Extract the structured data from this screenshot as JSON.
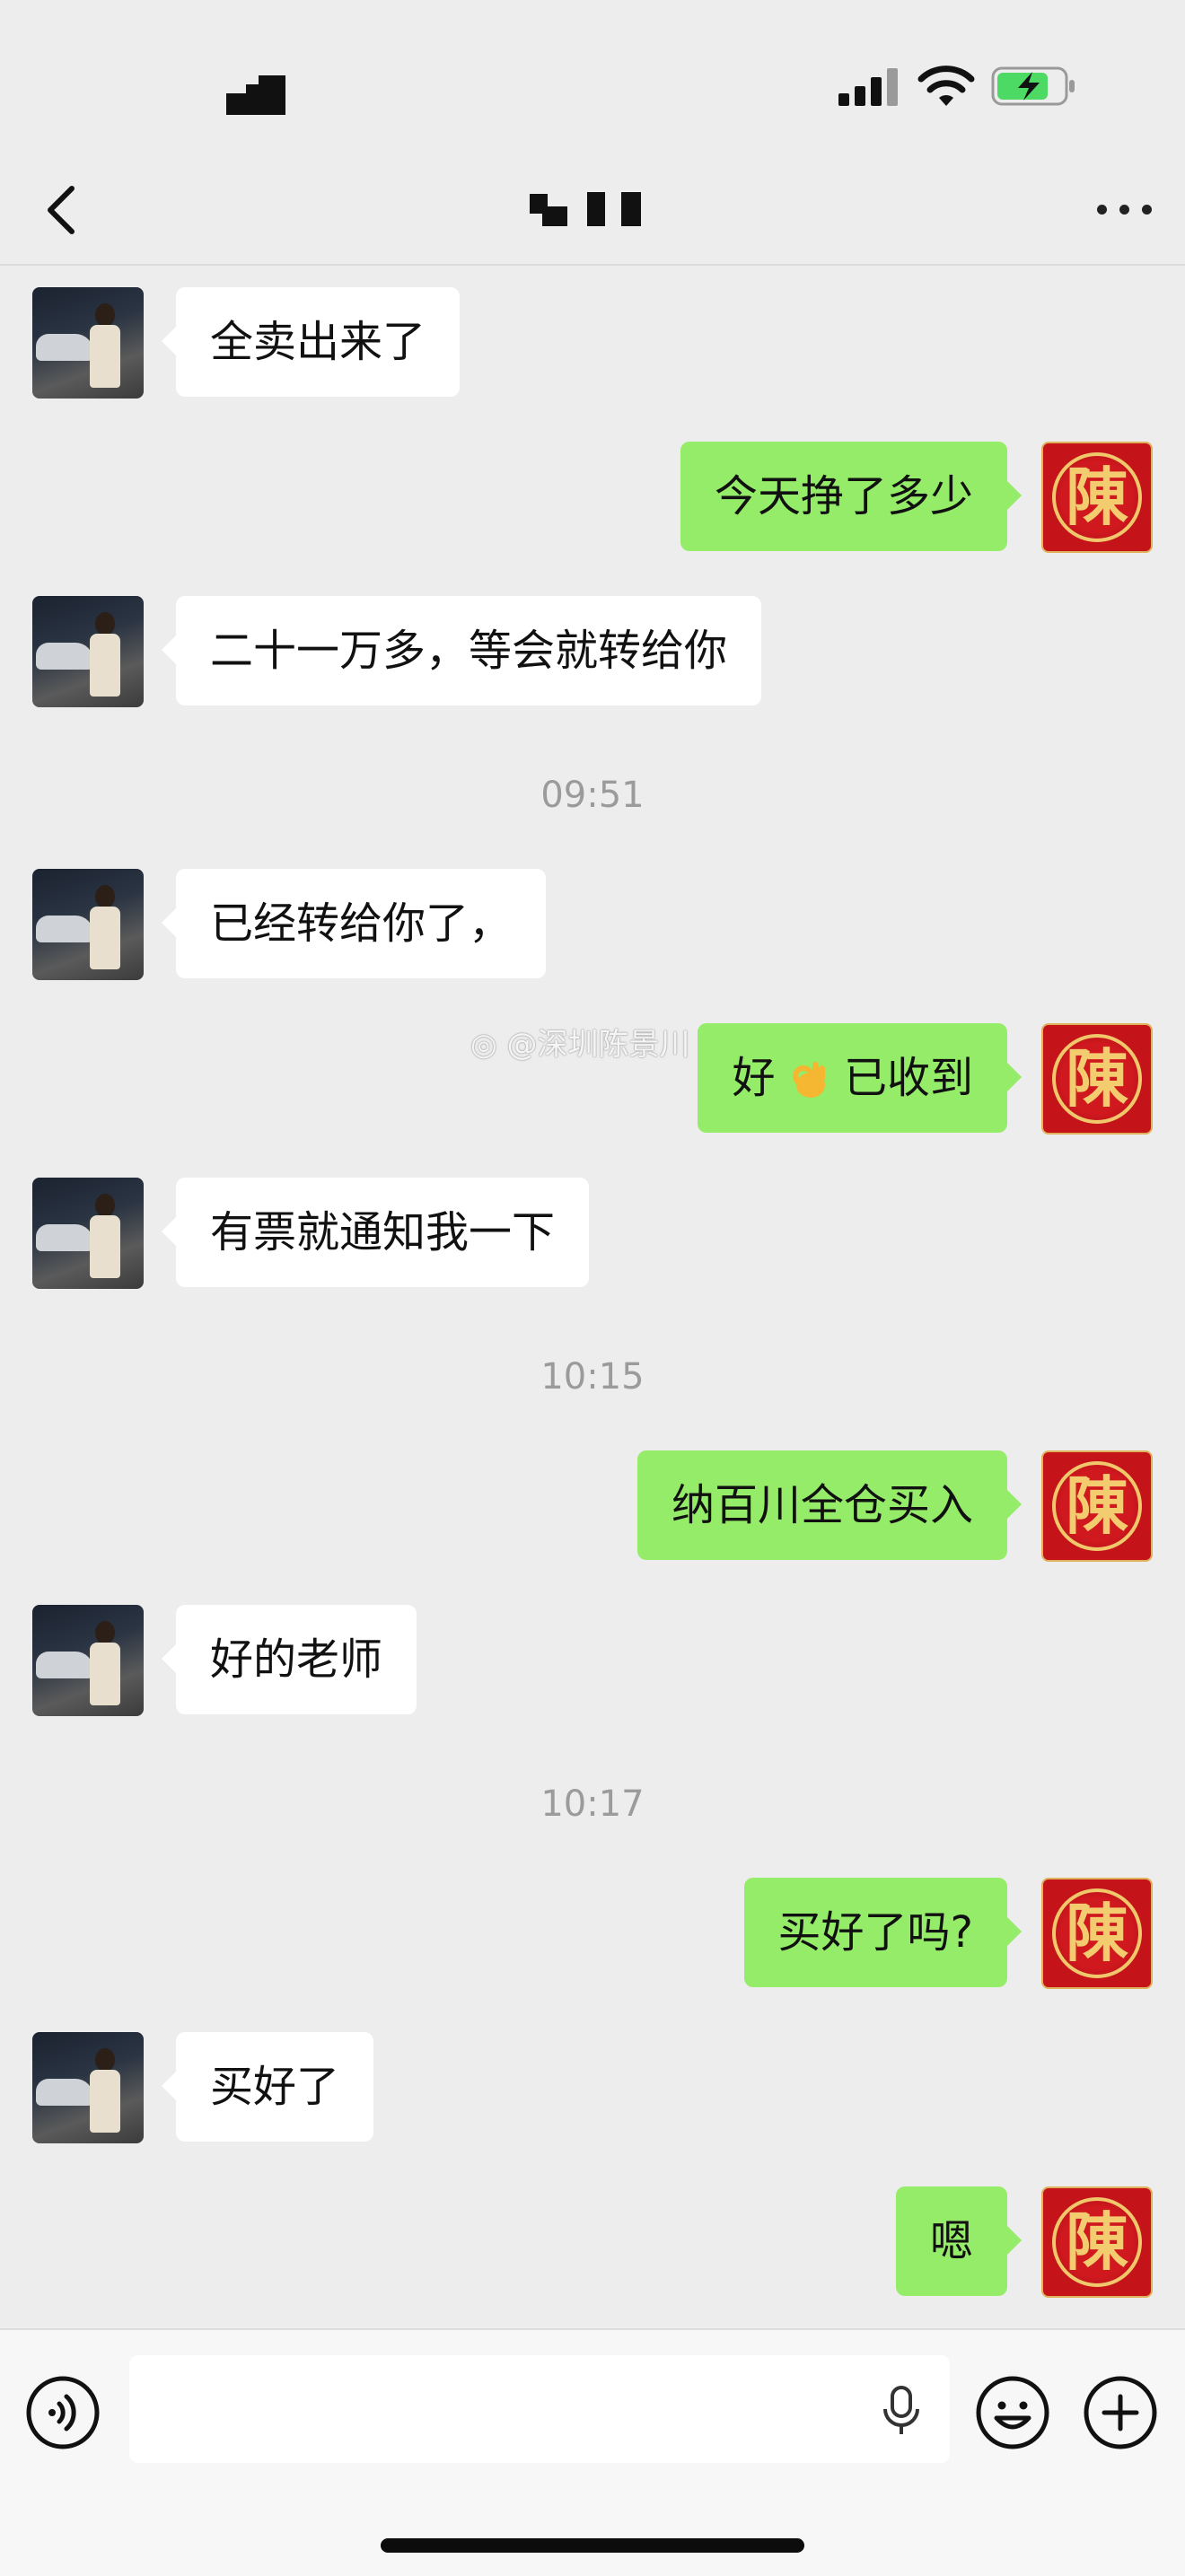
{
  "status_bar": {
    "time_redacted": "",
    "icons": [
      "signal-icon",
      "wifi-icon",
      "battery-charging-icon"
    ]
  },
  "nav": {
    "title_redacted": "",
    "back_icon": "chevron-left-icon",
    "more_icon": "more-dots-icon"
  },
  "messages": [
    {
      "side": "in",
      "text": "全卖出来了"
    },
    {
      "side": "out",
      "text": "今天挣了多少"
    },
    {
      "side": "in",
      "text": "二十一万多，等会就转给你"
    },
    {
      "side": "time",
      "text": "09:51"
    },
    {
      "side": "in",
      "text": "已经转给你了，"
    },
    {
      "side": "out",
      "text_before": "好",
      "emoji": "ok-hand-emoji",
      "text_after": "已收到"
    },
    {
      "side": "in",
      "text": "有票就通知我一下"
    },
    {
      "side": "time",
      "text": "10:15"
    },
    {
      "side": "out",
      "text": "纳百川全仓买入"
    },
    {
      "side": "in",
      "text": "好的老师"
    },
    {
      "side": "time",
      "text": "10:17"
    },
    {
      "side": "out",
      "text": "买好了吗?"
    },
    {
      "side": "in",
      "text": "买好了"
    },
    {
      "side": "out",
      "text": "嗯"
    }
  ],
  "my_avatar_glyph": "陳",
  "watermark": "@深圳陈景川",
  "input_bar": {
    "placeholder": "",
    "left_icon": "voice-icon",
    "mic_icon": "mic-icon",
    "emoji_icon": "emoji-icon",
    "plus_icon": "plus-icon"
  },
  "colors": {
    "background": "#ededed",
    "bubble_out": "#95ec69",
    "bubble_in": "#ffffff",
    "timestamp": "#9b9b9b",
    "my_avatar_red": "#c4141a",
    "my_avatar_gold": "#f3cc6f"
  }
}
